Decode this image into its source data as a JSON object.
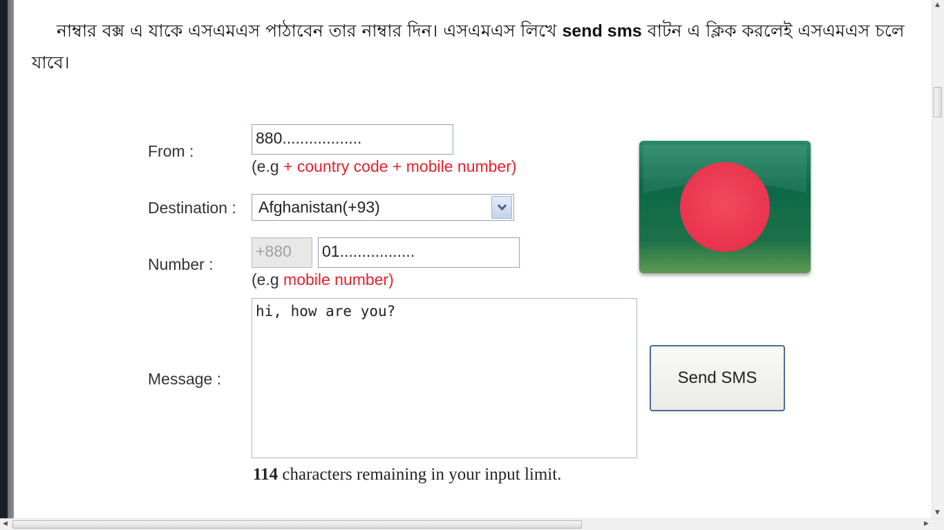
{
  "instructions": {
    "part1": "নাম্বার বক্স  এ যাকে এসএমএস পাঠাবেন তার নাম্বার দিন। এসএমএস লিখে ",
    "part2": "send sms",
    "part3": " বাটন এ ক্লিক করলেই এসএমএস চলে যাবে।"
  },
  "form": {
    "from_label": "From :",
    "from_value": "880..................",
    "from_hint_prefix": "(e.g ",
    "from_hint_red": "+ country code + mobile number)",
    "destination_label": "Destination :",
    "destination_value": "Afghanistan(+93)",
    "number_label": "Number :",
    "number_prefix": "+880",
    "number_value": "01.................",
    "number_hint_prefix": "(e.g ",
    "number_hint_red": "mobile number)",
    "message_label": "Message :",
    "message_value": "hi, how are you?",
    "send_button": "Send SMS",
    "counter_value": "114",
    "counter_text": " characters remaining in your input limit."
  },
  "flag": {
    "green": "#0b6a4a",
    "red": "#f0364f"
  },
  "icons": {
    "select_arrow": "chevron-down-icon",
    "scroll_up": "arrow-up-icon",
    "scroll_down": "arrow-down-icon",
    "scroll_left": "arrow-left-icon",
    "scroll_right": "arrow-right-icon"
  }
}
